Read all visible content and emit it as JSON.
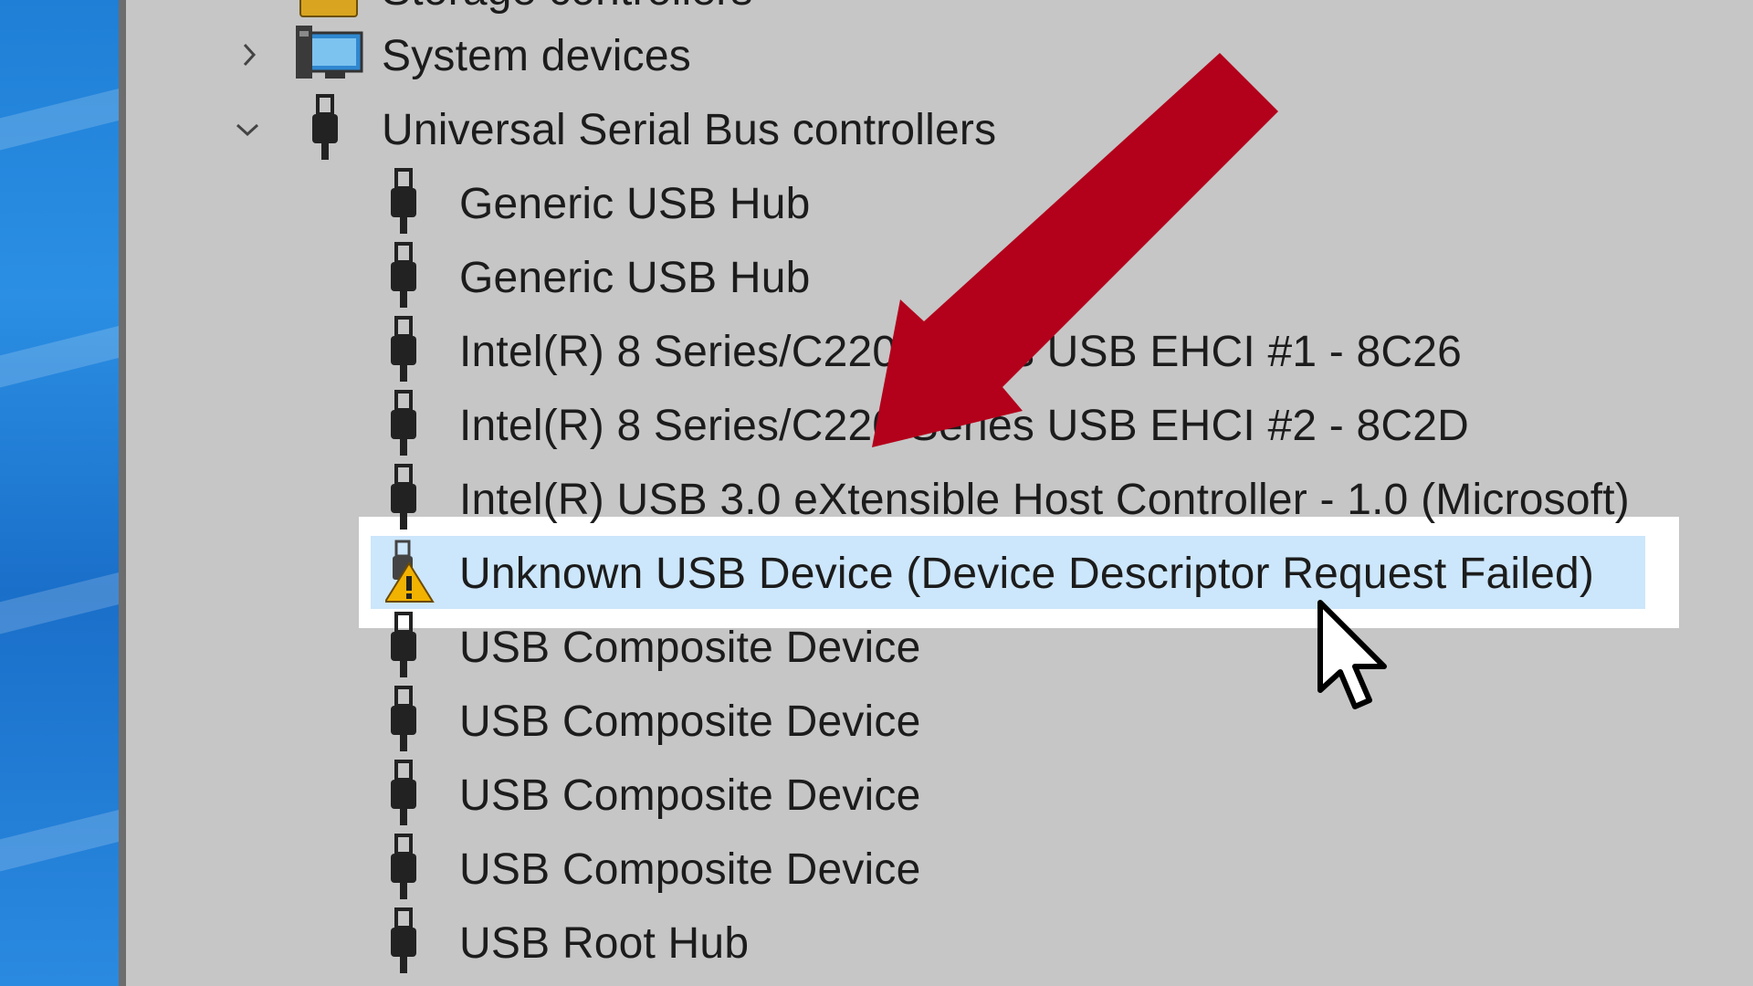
{
  "tree": {
    "partial_top_label": "Storage controllers",
    "categories": [
      {
        "label": "System devices",
        "expanded": false,
        "icon": "monitor-icon"
      },
      {
        "label": "Universal Serial Bus controllers",
        "expanded": true,
        "icon": "usb-plug-icon"
      }
    ],
    "usb_children": [
      {
        "label": "Generic USB Hub",
        "icon": "usb-plug-icon"
      },
      {
        "label": "Generic USB Hub",
        "icon": "usb-plug-icon"
      },
      {
        "label": "Intel(R) 8 Series/C220 Series USB EHCI #1 - 8C26",
        "icon": "usb-plug-icon"
      },
      {
        "label": "Intel(R) 8 Series/C220 Series USB EHCI #2 - 8C2D",
        "icon": "usb-plug-icon"
      },
      {
        "label": "Intel(R) USB 3.0 eXtensible Host Controller - 1.0 (Microsoft)",
        "icon": "usb-plug-icon"
      },
      {
        "label": "Unknown USB Device (Device Descriptor Request Failed)",
        "icon": "warning-icon",
        "selected": true
      },
      {
        "label": "USB Composite Device",
        "icon": "usb-plug-icon"
      },
      {
        "label": "USB Composite Device",
        "icon": "usb-plug-icon"
      },
      {
        "label": "USB Composite Device",
        "icon": "usb-plug-icon"
      },
      {
        "label": "USB Composite Device",
        "icon": "usb-plug-icon"
      },
      {
        "label": "USB Root Hub",
        "icon": "usb-plug-icon"
      }
    ]
  },
  "colors": {
    "background": "#c6c6c6",
    "selection": "#cce6fb",
    "annotation_arrow": "#b3001b",
    "warning": "#f2b200",
    "text": "#1c1c1c"
  }
}
